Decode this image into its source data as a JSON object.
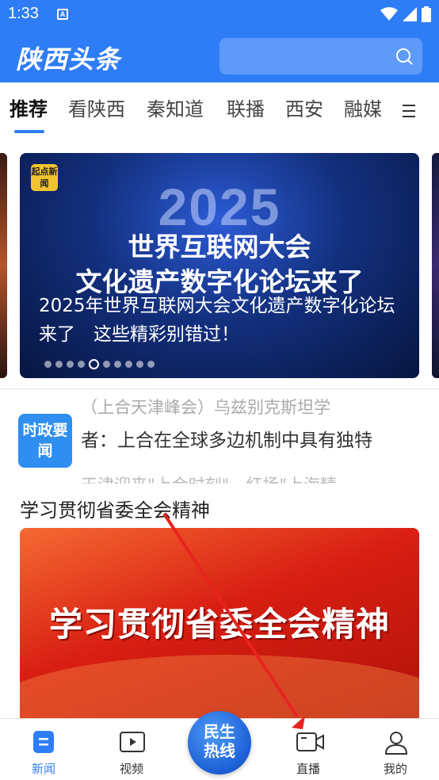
{
  "status_bar": {
    "time": "1:33",
    "notif_glyph": "A"
  },
  "header": {
    "logo": "陕西头条",
    "search_placeholder": ""
  },
  "tabs": [
    {
      "label": "推荐",
      "active": true
    },
    {
      "label": "看陕西"
    },
    {
      "label": "秦知道"
    },
    {
      "label": "联播"
    },
    {
      "label": "西安"
    },
    {
      "label": "融媒"
    }
  ],
  "carousel": {
    "badge": "起点新闻",
    "year": "2025",
    "headline_1": "世界互联网大会",
    "headline_2": "文化遗产数字化论坛来了",
    "caption": "2025年世界互联网大会文化遗产数字化论坛来了　这些精彩别错过！",
    "slide_count": 10,
    "active_index": 4
  },
  "ticker": {
    "badge": "时政要闻",
    "line_top": "（上合天津峰会）乌兹别克斯坦学",
    "line_main": "者：上合在全球多边机制中具有独特",
    "line_bottom": "天津迎来\"上合时刻\"　红场\"上海精"
  },
  "section": {
    "title": "学习贯彻省委全会精神",
    "promo_text": "学习贯彻省委全会精神"
  },
  "bottom_nav": {
    "items": [
      {
        "label": "新闻",
        "icon": "news-icon",
        "active": true
      },
      {
        "label": "视频",
        "icon": "video-icon"
      },
      {
        "label": "直播",
        "icon": "live-camera-icon"
      },
      {
        "label": "我的",
        "icon": "profile-icon"
      }
    ],
    "center": "民生热线"
  },
  "colors": {
    "brand_blue": "#2f7df6",
    "annotation_red": "#e8231f"
  }
}
